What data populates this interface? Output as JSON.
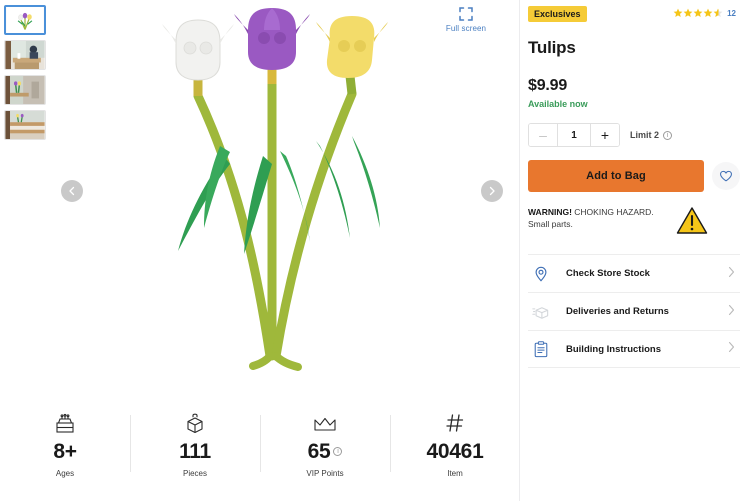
{
  "gallery": {
    "fullscreen_label": "Full screen",
    "fullscreen_icon": "expand-icon",
    "prev_icon": "chevron-left-icon",
    "next_icon": "chevron-right-icon",
    "thumbnails": [
      {
        "alt": "Tulips product shot",
        "type": "product",
        "active": true
      },
      {
        "alt": "Lifestyle scene with person at table",
        "type": "lifestyle",
        "active": false
      },
      {
        "alt": "Lifestyle scene with vase in room",
        "type": "lifestyle",
        "active": false
      },
      {
        "alt": "Lifestyle scene on wooden shelf",
        "type": "lifestyle",
        "active": false
      }
    ],
    "hero": {
      "alt": "LEGO Tulips build with white, purple and yellow flowers",
      "flower_colors": [
        "#f2f2f0",
        "#9a59c2",
        "#f3dc6a"
      ],
      "stem_color": "#9fb83b",
      "leaf_color": "#2f9e52"
    }
  },
  "stats": [
    {
      "icon": "cake-icon",
      "value": "8+",
      "label": "Ages",
      "info": false
    },
    {
      "icon": "brick-icon",
      "value": "111",
      "label": "Pieces",
      "info": false
    },
    {
      "icon": "crown-icon",
      "value": "65",
      "label": "VIP Points",
      "info": true
    },
    {
      "icon": "hash-icon",
      "value": "40461",
      "label": "Item",
      "info": false
    }
  ],
  "details": {
    "badge": "Exclusives",
    "rating": {
      "stars": 4.5,
      "count": "12",
      "star_color": "#f5c518"
    },
    "title": "Tulips",
    "price": "$9.99",
    "availability": "Available now",
    "quantity": {
      "value": "1",
      "minus_label": "–",
      "plus_label": "+",
      "limit_label": "Limit 2",
      "limit_info_icon": "info-icon"
    },
    "add_to_bag_label": "Add to Bag",
    "add_to_bag_color": "#e8772e",
    "wishlist_icon": "heart-icon",
    "warning": {
      "strong": "WARNING!",
      "text": " CHOKING HAZARD.",
      "line2": "Small parts.",
      "icon": "warning-triangle-icon"
    },
    "links": [
      {
        "icon": "location-pin-icon",
        "label": "Check Store Stock",
        "chevron": "chevron-right-icon"
      },
      {
        "icon": "delivery-box-icon",
        "label": "Deliveries and Returns",
        "chevron": "chevron-right-icon"
      },
      {
        "icon": "instructions-icon",
        "label": "Building Instructions",
        "chevron": "chevron-right-icon"
      }
    ]
  }
}
